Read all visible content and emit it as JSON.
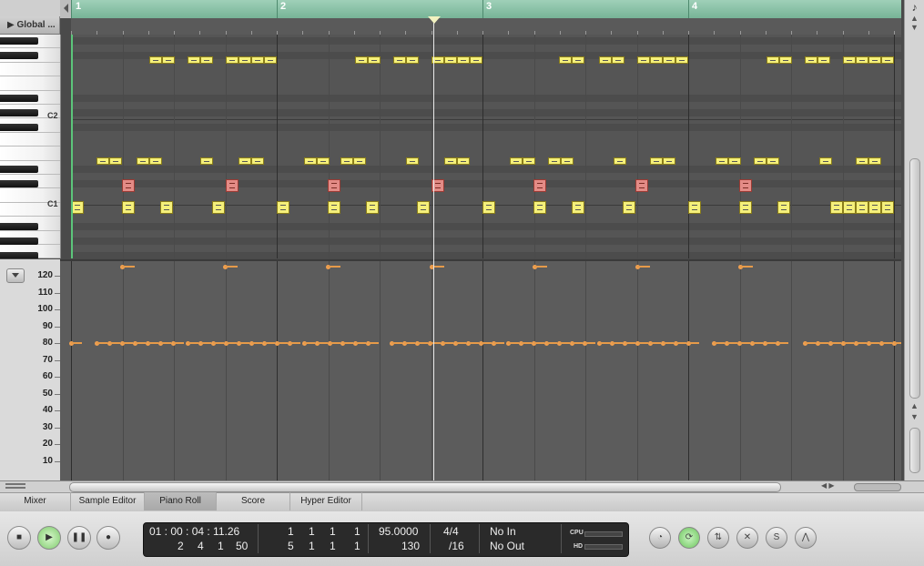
{
  "header": {
    "global_tracks": "Global ..."
  },
  "ruler": {
    "bars": [
      "1",
      "2",
      "3",
      "4"
    ]
  },
  "keyboard": {
    "labels": [
      "C2",
      "C1"
    ]
  },
  "velocity": {
    "labels": [
      "120",
      "110",
      "100",
      "90",
      "80",
      "70",
      "60",
      "50",
      "40",
      "30",
      "20",
      "10"
    ]
  },
  "tabs": [
    "Mixer",
    "Sample Editor",
    "Piano Roll",
    "Score",
    "Hyper Editor"
  ],
  "active_tab": "Piano Roll",
  "transport": {
    "smpte": "01 : 00 : 04 : 11.26",
    "bbt": [
      "2",
      "4",
      "1",
      "50"
    ],
    "locator_top": [
      "1",
      "1",
      "1",
      "1"
    ],
    "locator_bottom": [
      "5",
      "1",
      "1",
      "1"
    ],
    "tempo_top": "95.0000",
    "tempo_bottom": "130",
    "sig_top": "4/4",
    "sig_bottom": "/16",
    "midi_in": "No In",
    "midi_out": "No Out",
    "cpu_label": "CPU",
    "hd_label": "HD"
  },
  "colors": {
    "note": "#f5f07a",
    "note_selected": "#e38b86",
    "velocity": "#f0a050",
    "ruler": "#8fc6aa"
  },
  "icons": {
    "top_right": "music-note-icon"
  }
}
